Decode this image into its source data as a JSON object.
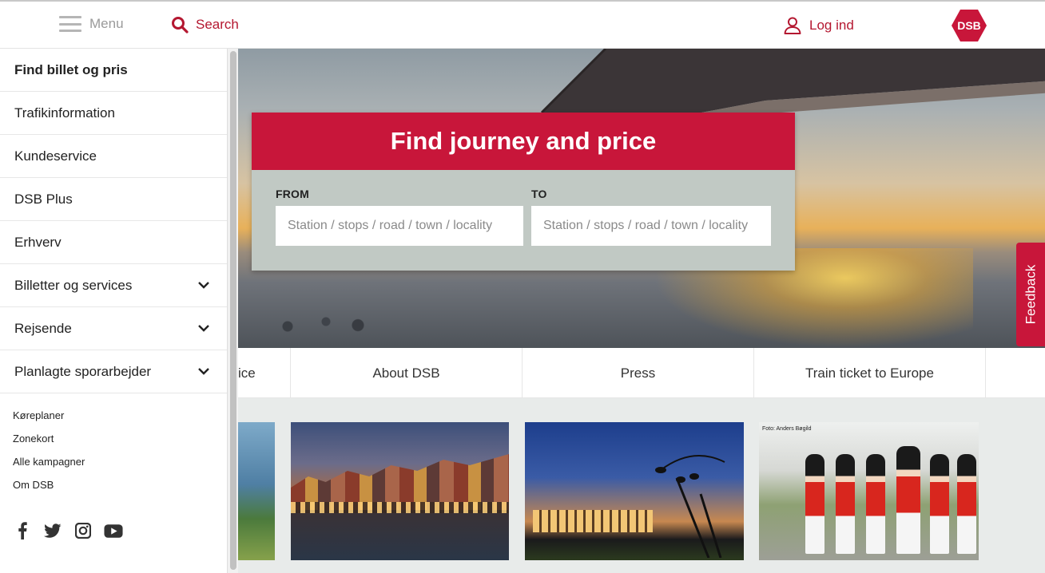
{
  "header": {
    "menu_label": "Menu",
    "search_label": "Search",
    "login_label": "Log ind",
    "logo_text": "DSB"
  },
  "sidemenu": {
    "items": [
      {
        "label": "Find billet og pris",
        "expandable": false
      },
      {
        "label": "Trafikinformation",
        "expandable": false
      },
      {
        "label": "Kundeservice",
        "expandable": false
      },
      {
        "label": "DSB Plus",
        "expandable": false
      },
      {
        "label": "Erhverv",
        "expandable": false
      },
      {
        "label": "Billetter og services",
        "expandable": true
      },
      {
        "label": "Rejsende",
        "expandable": true
      },
      {
        "label": "Planlagte sporarbejder",
        "expandable": true
      }
    ],
    "sublinks": [
      "Køreplaner",
      "Zonekort",
      "Alle kampagner",
      "Om DSB"
    ],
    "social_icons": [
      "facebook-icon",
      "twitter-icon",
      "instagram-icon",
      "youtube-icon"
    ]
  },
  "journey_search": {
    "title": "Find journey and price",
    "from_label": "FROM",
    "to_label": "TO",
    "from_placeholder": "Station / stops / road / town / locality",
    "to_placeholder": "Station / stops / road / town / locality"
  },
  "feedback_label": "Feedback",
  "nav_strip": {
    "items": [
      "ice",
      "About DSB",
      "Press",
      "Train ticket to Europe"
    ]
  },
  "cards": {
    "photo_credit": "Foto: Anders Bøgild"
  },
  "colors": {
    "brand_red": "#c8163a",
    "link_red": "#b41730",
    "form_grey": "#c1c9c4"
  }
}
